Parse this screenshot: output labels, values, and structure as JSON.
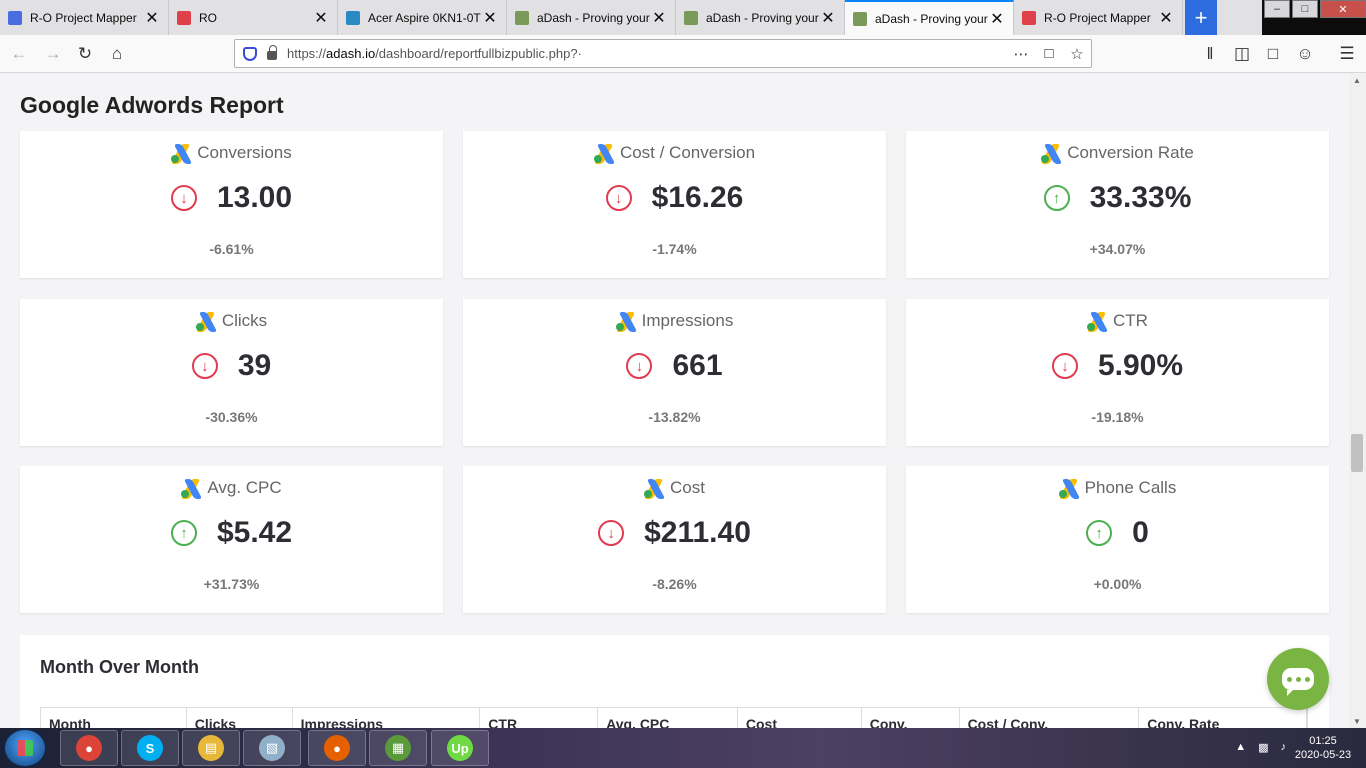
{
  "browser": {
    "tabs": [
      {
        "title": "R-O Project Mapper",
        "icon": "doc-icon",
        "color": "#4a6ee0",
        "active": false
      },
      {
        "title": "RO",
        "icon": "ro-icon",
        "color": "#e0404a",
        "active": false
      },
      {
        "title": "Acer Aspire 0KN1-0T",
        "icon": "c-icon",
        "color": "#2a8ac4",
        "active": false
      },
      {
        "title": "aDash - Proving your",
        "icon": "adash-icon",
        "color": "#7a9a5a",
        "active": false
      },
      {
        "title": "aDash - Proving your",
        "icon": "adash-icon",
        "color": "#7a9a5a",
        "active": false
      },
      {
        "title": "aDash - Proving your",
        "icon": "adash-icon",
        "color": "#7a9a5a",
        "active": true
      },
      {
        "title": "R-O Project Mapper",
        "icon": "ro-icon",
        "color": "#e0404a",
        "active": false
      }
    ],
    "url_prefix": "https://",
    "url_domain": "adash.io",
    "url_path": "/dashboard/reportfullbizpublic.php?·"
  },
  "report": {
    "title": "Google Adwords Report",
    "cards": [
      {
        "label": "Conversions",
        "value": "13.00",
        "change": "-6.61%",
        "trend": "down"
      },
      {
        "label": "Cost / Conversion",
        "value": "$16.26",
        "change": "-1.74%",
        "trend": "down"
      },
      {
        "label": "Conversion Rate",
        "value": "33.33%",
        "change": "+34.07%",
        "trend": "up"
      },
      {
        "label": "Clicks",
        "value": "39",
        "change": "-30.36%",
        "trend": "down"
      },
      {
        "label": "Impressions",
        "value": "661",
        "change": "-13.82%",
        "trend": "down"
      },
      {
        "label": "CTR",
        "value": "5.90%",
        "change": "-19.18%",
        "trend": "down"
      },
      {
        "label": "Avg. CPC",
        "value": "$5.42",
        "change": "+31.73%",
        "trend": "up"
      },
      {
        "label": "Cost",
        "value": "$211.40",
        "change": "-8.26%",
        "trend": "down"
      },
      {
        "label": "Phone Calls",
        "value": "0",
        "change": "+0.00%",
        "trend": "up"
      }
    ],
    "colors": {
      "down": "#e03b4f",
      "up": "#4caf50",
      "chat": "#7ab443"
    }
  },
  "month_over_month": {
    "title": "Month Over Month",
    "columns": [
      "Month",
      "Clicks",
      "Impressions",
      "CTR",
      "Avg. CPC",
      "Cost",
      "Conv.",
      "Cost / Conv.",
      "Conv. Rate"
    ]
  },
  "taskbar": {
    "time": "01:25",
    "date": "2020-05-23",
    "apps": [
      {
        "name": "chrome-icon",
        "color": "#db4437",
        "glyph": "●"
      },
      {
        "name": "skype-icon",
        "color": "#00aff0",
        "glyph": "S"
      },
      {
        "name": "folder-icon",
        "color": "#e8b83a",
        "glyph": "▤"
      },
      {
        "name": "notepad-icon",
        "color": "#8fb0c8",
        "glyph": "▧"
      },
      {
        "name": "firefox-icon",
        "color": "#e66000",
        "glyph": "●"
      },
      {
        "name": "sheet-icon",
        "color": "#5a9a3a",
        "glyph": "▦"
      },
      {
        "name": "upwork-icon",
        "color": "#6fda44",
        "glyph": "Up"
      }
    ]
  }
}
